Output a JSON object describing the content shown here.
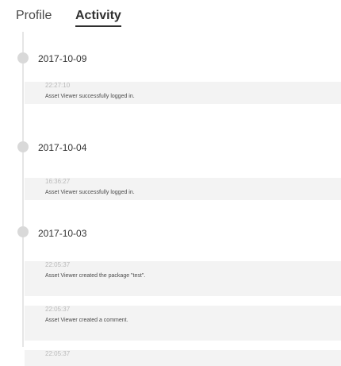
{
  "tabs": {
    "profile": "Profile",
    "activity": "Activity"
  },
  "timeline": {
    "groups": [
      {
        "date": "2017-10-09",
        "items": [
          {
            "time": "22:27:10",
            "text": "Asset Viewer successfully logged in."
          }
        ]
      },
      {
        "date": "2017-10-04",
        "items": [
          {
            "time": "16:36:27",
            "text": "Asset Viewer successfully logged in."
          }
        ]
      },
      {
        "date": "2017-10-03",
        "items": [
          {
            "time": "22:05:37",
            "text": "Asset Viewer created the package \"test\"."
          },
          {
            "time": "22:05:37",
            "text": "Asset Viewer created a comment."
          },
          {
            "time": "22:05:37",
            "text": ""
          }
        ]
      }
    ]
  }
}
